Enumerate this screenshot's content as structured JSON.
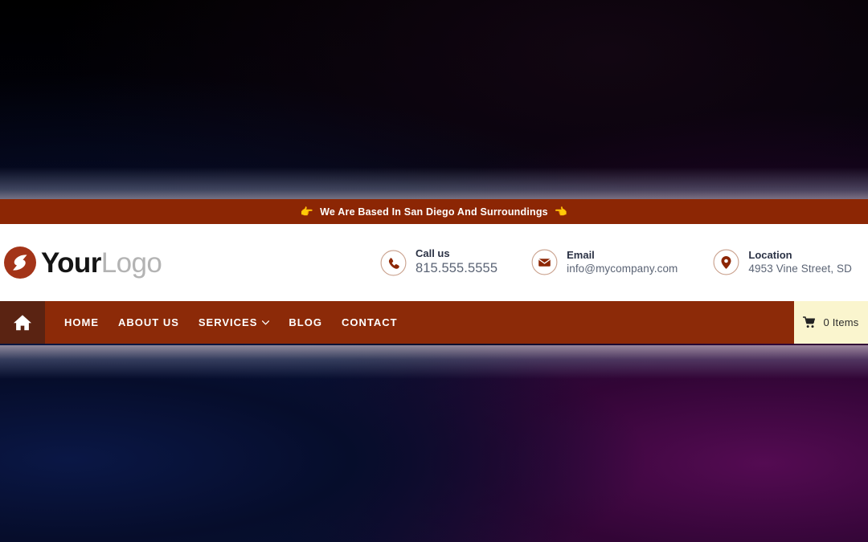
{
  "announcement": {
    "text": "We Are Based In San Diego And Surroundings",
    "left_emoji": "👉",
    "right_emoji": "👈"
  },
  "header": {
    "logo": {
      "mark_name": "logo-mark-icon",
      "primary": "Your",
      "secondary": "Logo"
    },
    "contacts": [
      {
        "icon": "phone-icon",
        "label": "Call us",
        "value": "815.555.5555"
      },
      {
        "icon": "envelope-icon",
        "label": "Email",
        "value": "info@mycompany.com"
      },
      {
        "icon": "map-pin-icon",
        "label": "Location",
        "value": "4953 Vine Street, SD"
      }
    ]
  },
  "nav": {
    "home_icon": "home-icon",
    "items": [
      {
        "label": "HOME",
        "has_dropdown": false
      },
      {
        "label": "ABOUT US",
        "has_dropdown": false
      },
      {
        "label": "SERVICES",
        "has_dropdown": true
      },
      {
        "label": "BLOG",
        "has_dropdown": false
      },
      {
        "label": "CONTACT",
        "has_dropdown": false
      }
    ],
    "cart": {
      "icon": "shopping-cart-icon",
      "label": "0 Items"
    }
  },
  "colors": {
    "announcement_bg": "#8c2604",
    "nav_bg": "#8c2a08",
    "home_block_bg": "#5a2312",
    "cart_bg": "#faf5ce",
    "brand_rust": "#a33418",
    "header_bg": "#ffffff"
  }
}
